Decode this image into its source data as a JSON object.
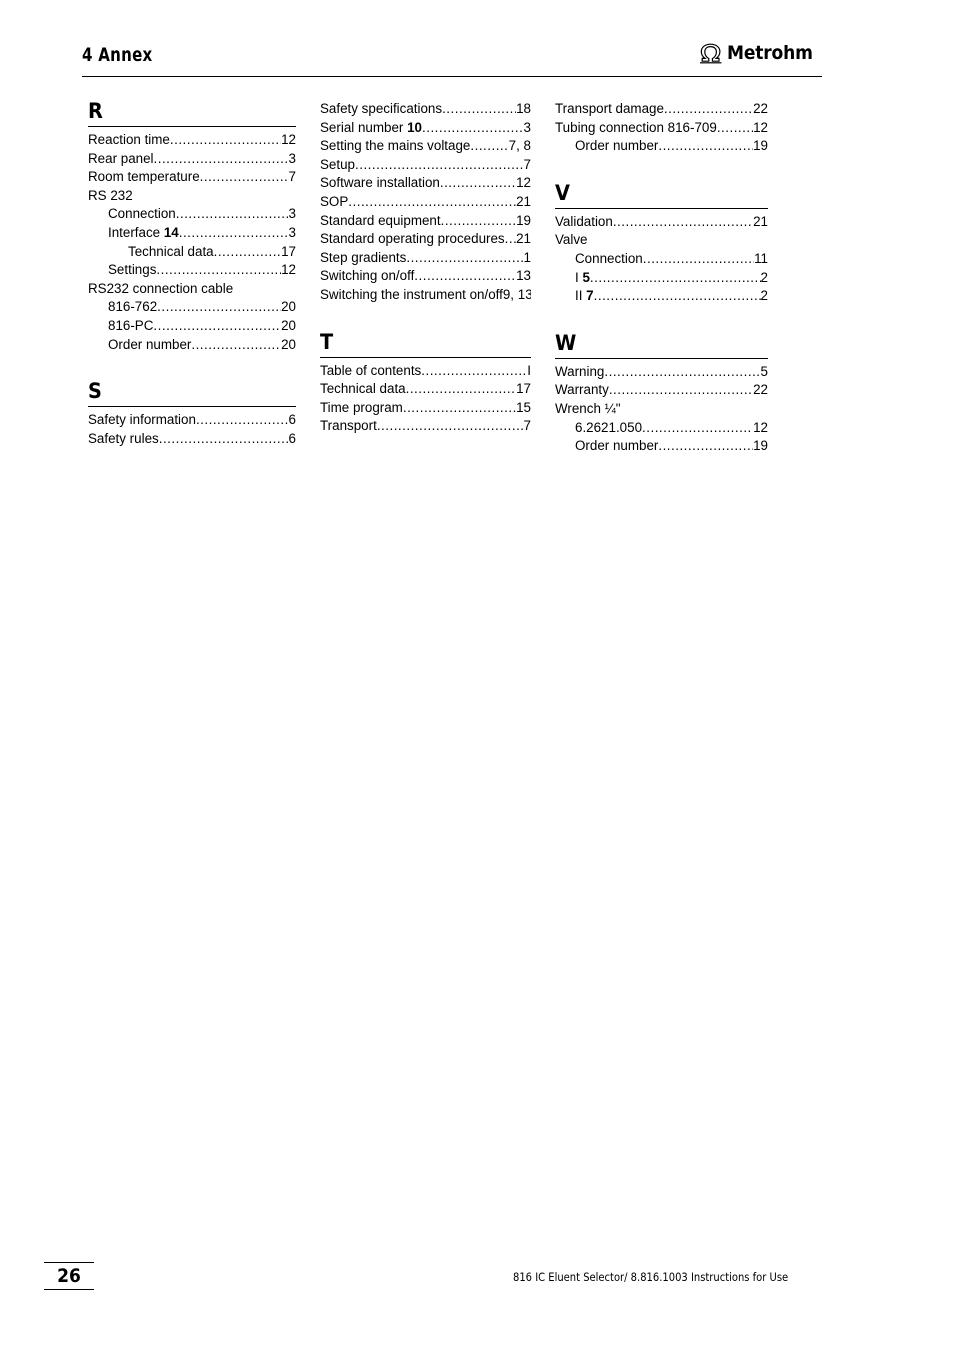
{
  "header": {
    "title": "4 Annex",
    "brand": "Metrohm",
    "brand_mark": "omega-logo-icon"
  },
  "footer": {
    "page_number": "26",
    "text": "816 IC Eluent Selector/ 8.816.1003 Instructions for Use"
  },
  "columns": [
    {
      "id": "column-left",
      "sections": [
        {
          "letter": "R",
          "entries": [
            {
              "label": "Reaction time",
              "page": "12",
              "level": 1,
              "leaders": true
            },
            {
              "label": "Rear panel ",
              "page": "3",
              "level": 1,
              "leaders": true
            },
            {
              "label": "Room temperature ",
              "page": "7",
              "level": 1,
              "leaders": true
            },
            {
              "label": "RS 232",
              "page": "",
              "level": 1,
              "leaders": false
            },
            {
              "label": "Connection ",
              "page": "3",
              "level": 2,
              "leaders": true
            },
            {
              "label": "Interface ",
              "label_bold": "14",
              "page": "3",
              "level": 2,
              "leaders": true
            },
            {
              "label": "Technical data",
              "page": "17",
              "level": 3,
              "leaders": true
            },
            {
              "label": "Settings",
              "page": "12",
              "level": 2,
              "leaders": true
            },
            {
              "label": "RS232 connection cable",
              "page": "",
              "level": 1,
              "leaders": false
            },
            {
              "label": "816-762",
              "page": "20",
              "level": 2,
              "leaders": true
            },
            {
              "label": "816-PC",
              "page": "20",
              "level": 2,
              "leaders": true
            },
            {
              "label": "Order number",
              "page": "20",
              "level": 2,
              "leaders": true
            }
          ]
        },
        {
          "letter": "S",
          "entries": [
            {
              "label": "Safety information",
              "page": "6",
              "level": 1,
              "leaders": true
            },
            {
              "label": "Safety rules ",
              "page": "6",
              "level": 1,
              "leaders": true
            }
          ]
        }
      ]
    },
    {
      "id": "column-middle",
      "sections": [
        {
          "letter": "",
          "entries": [
            {
              "label": "Safety specifications",
              "page": "18",
              "level": 1,
              "leaders": true
            },
            {
              "label": "Serial number ",
              "label_bold": "10",
              "page": "3",
              "level": 1,
              "leaders": true
            },
            {
              "label": "Setting the mains voltage ",
              "page": "7, 8",
              "level": 1,
              "leaders": true
            },
            {
              "label": "Setup",
              "page": "7",
              "level": 1,
              "leaders": true
            },
            {
              "label": "Software installation",
              "page": "12",
              "level": 1,
              "leaders": true
            },
            {
              "label": "SOP",
              "page": "21",
              "level": 1,
              "leaders": true
            },
            {
              "label": "Standard equipment",
              "page": "19",
              "level": 1,
              "leaders": true
            },
            {
              "label": "Standard operating procedures ",
              "page": "21",
              "level": 1,
              "leaders": true
            },
            {
              "label": "Step gradients ",
              "page": "1",
              "level": 1,
              "leaders": true
            },
            {
              "label": "Switching on/off ",
              "page": "13",
              "level": 1,
              "leaders": true
            },
            {
              "label": "Switching the instrument on/off9, 13",
              "page": "",
              "level": 1,
              "leaders": false
            }
          ]
        },
        {
          "letter": "T",
          "entries": [
            {
              "label": "Table of contents ",
              "page": "I",
              "level": 1,
              "leaders": true
            },
            {
              "label": "Technical data ",
              "page": "17",
              "level": 1,
              "leaders": true
            },
            {
              "label": "Time program ",
              "page": "15",
              "level": 1,
              "leaders": true
            },
            {
              "label": "Transport",
              "page": "7",
              "level": 1,
              "leaders": true
            }
          ]
        }
      ]
    },
    {
      "id": "column-right",
      "sections": [
        {
          "letter": "",
          "entries": [
            {
              "label": "Transport damage ",
              "page": "22",
              "level": 1,
              "leaders": true
            },
            {
              "label": "Tubing connection 816-709",
              "page": "12",
              "level": 1,
              "leaders": true
            },
            {
              "label": "Order number ",
              "page": "19",
              "level": 2,
              "leaders": true
            }
          ]
        },
        {
          "letter": "V",
          "entries": [
            {
              "label": "Validation",
              "page": "21",
              "level": 1,
              "leaders": true
            },
            {
              "label": "Valve",
              "page": "",
              "level": 1,
              "leaders": false
            },
            {
              "label": "Connection",
              "page": "11",
              "level": 2,
              "leaders": true
            },
            {
              "label": "I ",
              "label_bold": "5",
              "page": "2",
              "level": 2,
              "leaders": true
            },
            {
              "label": "II ",
              "label_bold": "7",
              "page": "2",
              "level": 2,
              "leaders": true
            }
          ]
        },
        {
          "letter": "W",
          "entries": [
            {
              "label": "Warning ",
              "page": "5",
              "level": 1,
              "leaders": true
            },
            {
              "label": "Warranty ",
              "page": "22",
              "level": 1,
              "leaders": true
            },
            {
              "label": "Wrench ¼\"",
              "page": "",
              "level": 1,
              "leaders": false
            },
            {
              "label": "6.2621.050 ",
              "page": "12",
              "level": 2,
              "leaders": true
            },
            {
              "label": "Order number ",
              "page": "19",
              "level": 2,
              "leaders": true
            }
          ]
        }
      ]
    }
  ]
}
